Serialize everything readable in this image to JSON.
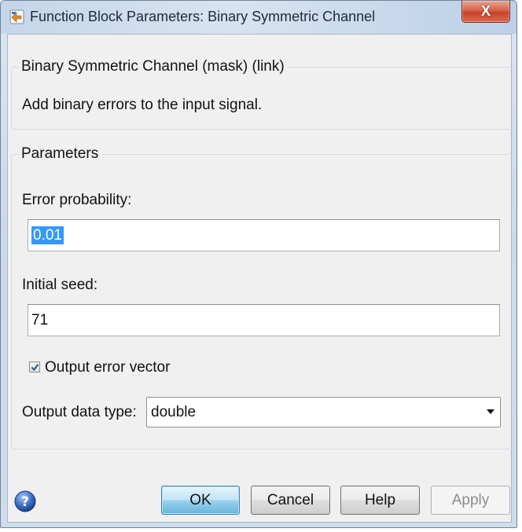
{
  "window": {
    "title": "Function Block Parameters: Binary Symmetric Channel",
    "close_label": "X"
  },
  "description_group": {
    "legend": "Binary Symmetric Channel (mask) (link)",
    "text": "Add binary errors to the input signal."
  },
  "parameters": {
    "legend": "Parameters",
    "error_probability": {
      "label": "Error probability:",
      "value": "0.01"
    },
    "initial_seed": {
      "label": "Initial seed:",
      "value": "71"
    },
    "output_error_vector": {
      "label": "Output error vector",
      "checked": true
    },
    "output_data_type": {
      "label": "Output data type:",
      "value": "double"
    }
  },
  "buttons": {
    "ok": "OK",
    "cancel": "Cancel",
    "help": "Help",
    "apply": "Apply"
  },
  "icons": {
    "app": "simulink-block-icon",
    "help": "question-mark-icon",
    "checkbox": "checkmark-icon",
    "dropdown": "triangle-down-icon"
  },
  "colors": {
    "default_button": "#98d1ef",
    "close_button": "#c8432a",
    "selection": "#3399ff"
  }
}
